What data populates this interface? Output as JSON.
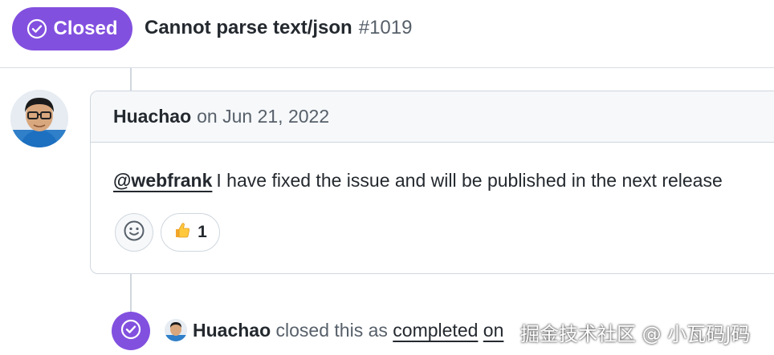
{
  "issue": {
    "state_label": "Closed",
    "title": "Cannot parse text/json",
    "number": "#1019"
  },
  "comment": {
    "author": "Huachao",
    "date": "on Jun 21, 2022",
    "mention": "@webfrank",
    "text": "I have fixed the issue and will be published in the next release",
    "reactions": {
      "picker_icon": "smiley-icon",
      "thumbs_up_icon": "thumbs-up-icon",
      "thumbs_up_count": "1"
    }
  },
  "event": {
    "icon": "check-circle-icon",
    "author": "Huachao",
    "action": "closed this as",
    "reason": "completed",
    "on": "on"
  },
  "watermark": "掘金技术社区 @ 小瓦码J码",
  "colors": {
    "closed_purple": "#8250df",
    "border": "#d0d7de",
    "header_bg": "#f6f8fa",
    "text": "#24292f",
    "muted": "#57606a"
  }
}
